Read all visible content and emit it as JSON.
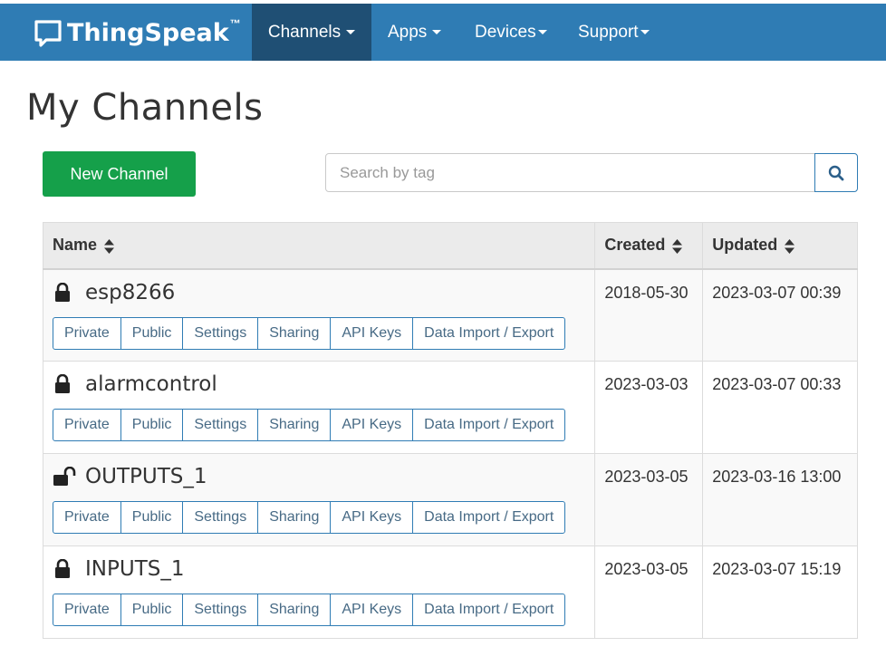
{
  "brand": {
    "name": "ThingSpeak",
    "tm": "™"
  },
  "nav": [
    {
      "label": "Channels",
      "active": true
    },
    {
      "label": "Apps",
      "active": false
    },
    {
      "label": "Devices",
      "active": false
    },
    {
      "label": "Support",
      "active": false
    }
  ],
  "page_title": "My Channels",
  "new_channel_label": "New Channel",
  "search": {
    "placeholder": "Search by tag",
    "value": ""
  },
  "table": {
    "headers": {
      "name": "Name",
      "created": "Created",
      "updated": "Updated"
    },
    "action_labels": [
      "Private",
      "Public",
      "Settings",
      "Sharing",
      "API Keys",
      "Data Import / Export"
    ],
    "rows": [
      {
        "name": "esp8266",
        "lock": "lock-icon",
        "created": "2018-05-30",
        "updated": "2023-03-07 00:39"
      },
      {
        "name": "alarmcontrol",
        "lock": "lock-icon",
        "created": "2023-03-03",
        "updated": "2023-03-07 00:33"
      },
      {
        "name": "OUTPUTS_1",
        "lock": "unlock-icon",
        "created": "2023-03-05",
        "updated": "2023-03-16 13:00"
      },
      {
        "name": "INPUTS_1",
        "lock": "lock-icon",
        "created": "2023-03-05",
        "updated": "2023-03-07 15:19"
      }
    ]
  },
  "colors": {
    "navbar": "#2f7cb4",
    "nav_active": "#1f4f74",
    "new_button": "#15a04a",
    "action_border": "#2f7cb4"
  }
}
